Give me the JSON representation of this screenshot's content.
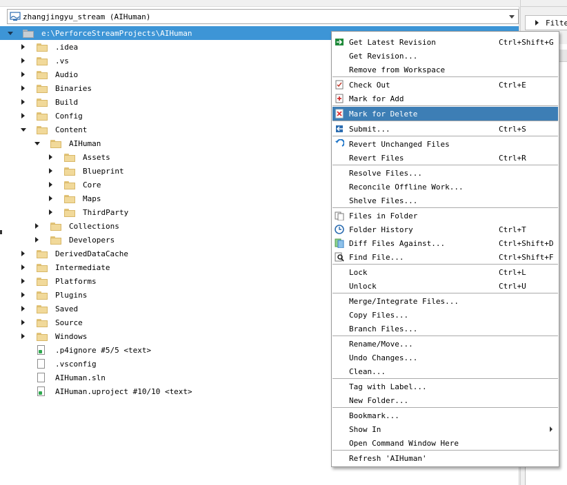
{
  "workspace": {
    "name": "zhangjingyu_stream (AIHuman)"
  },
  "tree": {
    "root": "e:\\PerforceStreamProjects\\AIHuman",
    "items": [
      {
        "label": ".idea",
        "kind": "folder",
        "depth": 1,
        "state": "closed"
      },
      {
        "label": ".vs",
        "kind": "folder",
        "depth": 1,
        "state": "closed"
      },
      {
        "label": "Audio",
        "kind": "folder",
        "depth": 1,
        "state": "closed"
      },
      {
        "label": "Binaries",
        "kind": "folder",
        "depth": 1,
        "state": "closed"
      },
      {
        "label": "Build",
        "kind": "folder",
        "depth": 1,
        "state": "closed"
      },
      {
        "label": "Config",
        "kind": "folder",
        "depth": 1,
        "state": "closed"
      },
      {
        "label": "Content",
        "kind": "folder",
        "depth": 1,
        "state": "open"
      },
      {
        "label": "AIHuman",
        "kind": "folder",
        "depth": 2,
        "state": "open"
      },
      {
        "label": "Assets",
        "kind": "folder",
        "depth": 3,
        "state": "closed"
      },
      {
        "label": "Blueprint",
        "kind": "folder",
        "depth": 3,
        "state": "closed"
      },
      {
        "label": "Core",
        "kind": "folder",
        "depth": 3,
        "state": "closed"
      },
      {
        "label": "Maps",
        "kind": "folder",
        "depth": 3,
        "state": "closed"
      },
      {
        "label": "ThirdParty",
        "kind": "folder",
        "depth": 3,
        "state": "closed"
      },
      {
        "label": "Collections",
        "kind": "folder",
        "depth": 2,
        "state": "closed"
      },
      {
        "label": "Developers",
        "kind": "folder",
        "depth": 2,
        "state": "closed"
      },
      {
        "label": "DerivedDataCache",
        "kind": "folder",
        "depth": 1,
        "state": "closed"
      },
      {
        "label": "Intermediate",
        "kind": "folder",
        "depth": 1,
        "state": "closed"
      },
      {
        "label": "Platforms",
        "kind": "folder",
        "depth": 1,
        "state": "closed"
      },
      {
        "label": "Plugins",
        "kind": "folder",
        "depth": 1,
        "state": "closed"
      },
      {
        "label": "Saved",
        "kind": "folder",
        "depth": 1,
        "state": "closed"
      },
      {
        "label": "Source",
        "kind": "folder",
        "depth": 1,
        "state": "closed"
      },
      {
        "label": "Windows",
        "kind": "folder",
        "depth": 1,
        "state": "closed"
      },
      {
        "label": ".p4ignore #5/5 <text>",
        "kind": "file-depot",
        "depth": 1,
        "state": ""
      },
      {
        "label": ".vsconfig",
        "kind": "file",
        "depth": 1,
        "state": ""
      },
      {
        "label": "AIHuman.sln",
        "kind": "file",
        "depth": 1,
        "state": ""
      },
      {
        "label": "AIHuman.uproject #10/10 <text>",
        "kind": "file-depot",
        "depth": 1,
        "state": ""
      }
    ]
  },
  "right_panel": {
    "filter_label": "Filte"
  },
  "context_menu": {
    "highlighted": "Mark for Delete",
    "groups": [
      [
        {
          "label": "Get Latest Revision",
          "shortcut": "Ctrl+Shift+G",
          "icon": "get-latest-icon"
        },
        {
          "label": "Get Revision...",
          "shortcut": "",
          "icon": ""
        },
        {
          "label": "Remove from Workspace",
          "shortcut": "",
          "icon": ""
        }
      ],
      [
        {
          "label": "Check Out",
          "shortcut": "Ctrl+E",
          "icon": "checkout-icon"
        },
        {
          "label": "Mark for Add",
          "shortcut": "",
          "icon": "mark-add-icon"
        }
      ],
      [
        {
          "label": "Mark for Delete",
          "shortcut": "",
          "icon": "mark-delete-icon"
        }
      ],
      [
        {
          "label": "Submit...",
          "shortcut": "Ctrl+S",
          "icon": "submit-icon"
        }
      ],
      [
        {
          "label": "Revert Unchanged Files",
          "shortcut": "",
          "icon": "revert-icon"
        },
        {
          "label": "Revert Files",
          "shortcut": "Ctrl+R",
          "icon": ""
        }
      ],
      [
        {
          "label": "Resolve Files...",
          "shortcut": "",
          "icon": ""
        },
        {
          "label": "Reconcile Offline Work...",
          "shortcut": "",
          "icon": ""
        },
        {
          "label": "Shelve Files...",
          "shortcut": "",
          "icon": ""
        }
      ],
      [
        {
          "label": "Files in Folder",
          "shortcut": "",
          "icon": "files-in-folder-icon"
        },
        {
          "label": "Folder History",
          "shortcut": "Ctrl+T",
          "icon": "history-icon"
        },
        {
          "label": "Diff Files Against...",
          "shortcut": "Ctrl+Shift+D",
          "icon": "diff-icon"
        },
        {
          "label": "Find File...",
          "shortcut": "Ctrl+Shift+F",
          "icon": "find-icon"
        }
      ],
      [
        {
          "label": "Lock",
          "shortcut": "Ctrl+L",
          "icon": ""
        },
        {
          "label": "Unlock",
          "shortcut": "Ctrl+U",
          "icon": ""
        }
      ],
      [
        {
          "label": "Merge/Integrate Files...",
          "shortcut": "",
          "icon": ""
        },
        {
          "label": "Copy Files...",
          "shortcut": "",
          "icon": ""
        },
        {
          "label": "Branch Files...",
          "shortcut": "",
          "icon": ""
        }
      ],
      [
        {
          "label": "Rename/Move...",
          "shortcut": "",
          "icon": ""
        },
        {
          "label": "Undo Changes...",
          "shortcut": "",
          "icon": ""
        },
        {
          "label": "Clean...",
          "shortcut": "",
          "icon": ""
        }
      ],
      [
        {
          "label": "Tag with Label...",
          "shortcut": "",
          "icon": ""
        },
        {
          "label": "New Folder...",
          "shortcut": "",
          "icon": ""
        }
      ],
      [
        {
          "label": "Bookmark...",
          "shortcut": "",
          "icon": ""
        },
        {
          "label": "Show In",
          "shortcut": "",
          "icon": "",
          "submenu": true
        },
        {
          "label": "Open Command Window Here",
          "shortcut": "",
          "icon": ""
        }
      ],
      [
        {
          "label": "Refresh 'AIHuman'",
          "shortcut": "",
          "icon": ""
        }
      ]
    ]
  }
}
